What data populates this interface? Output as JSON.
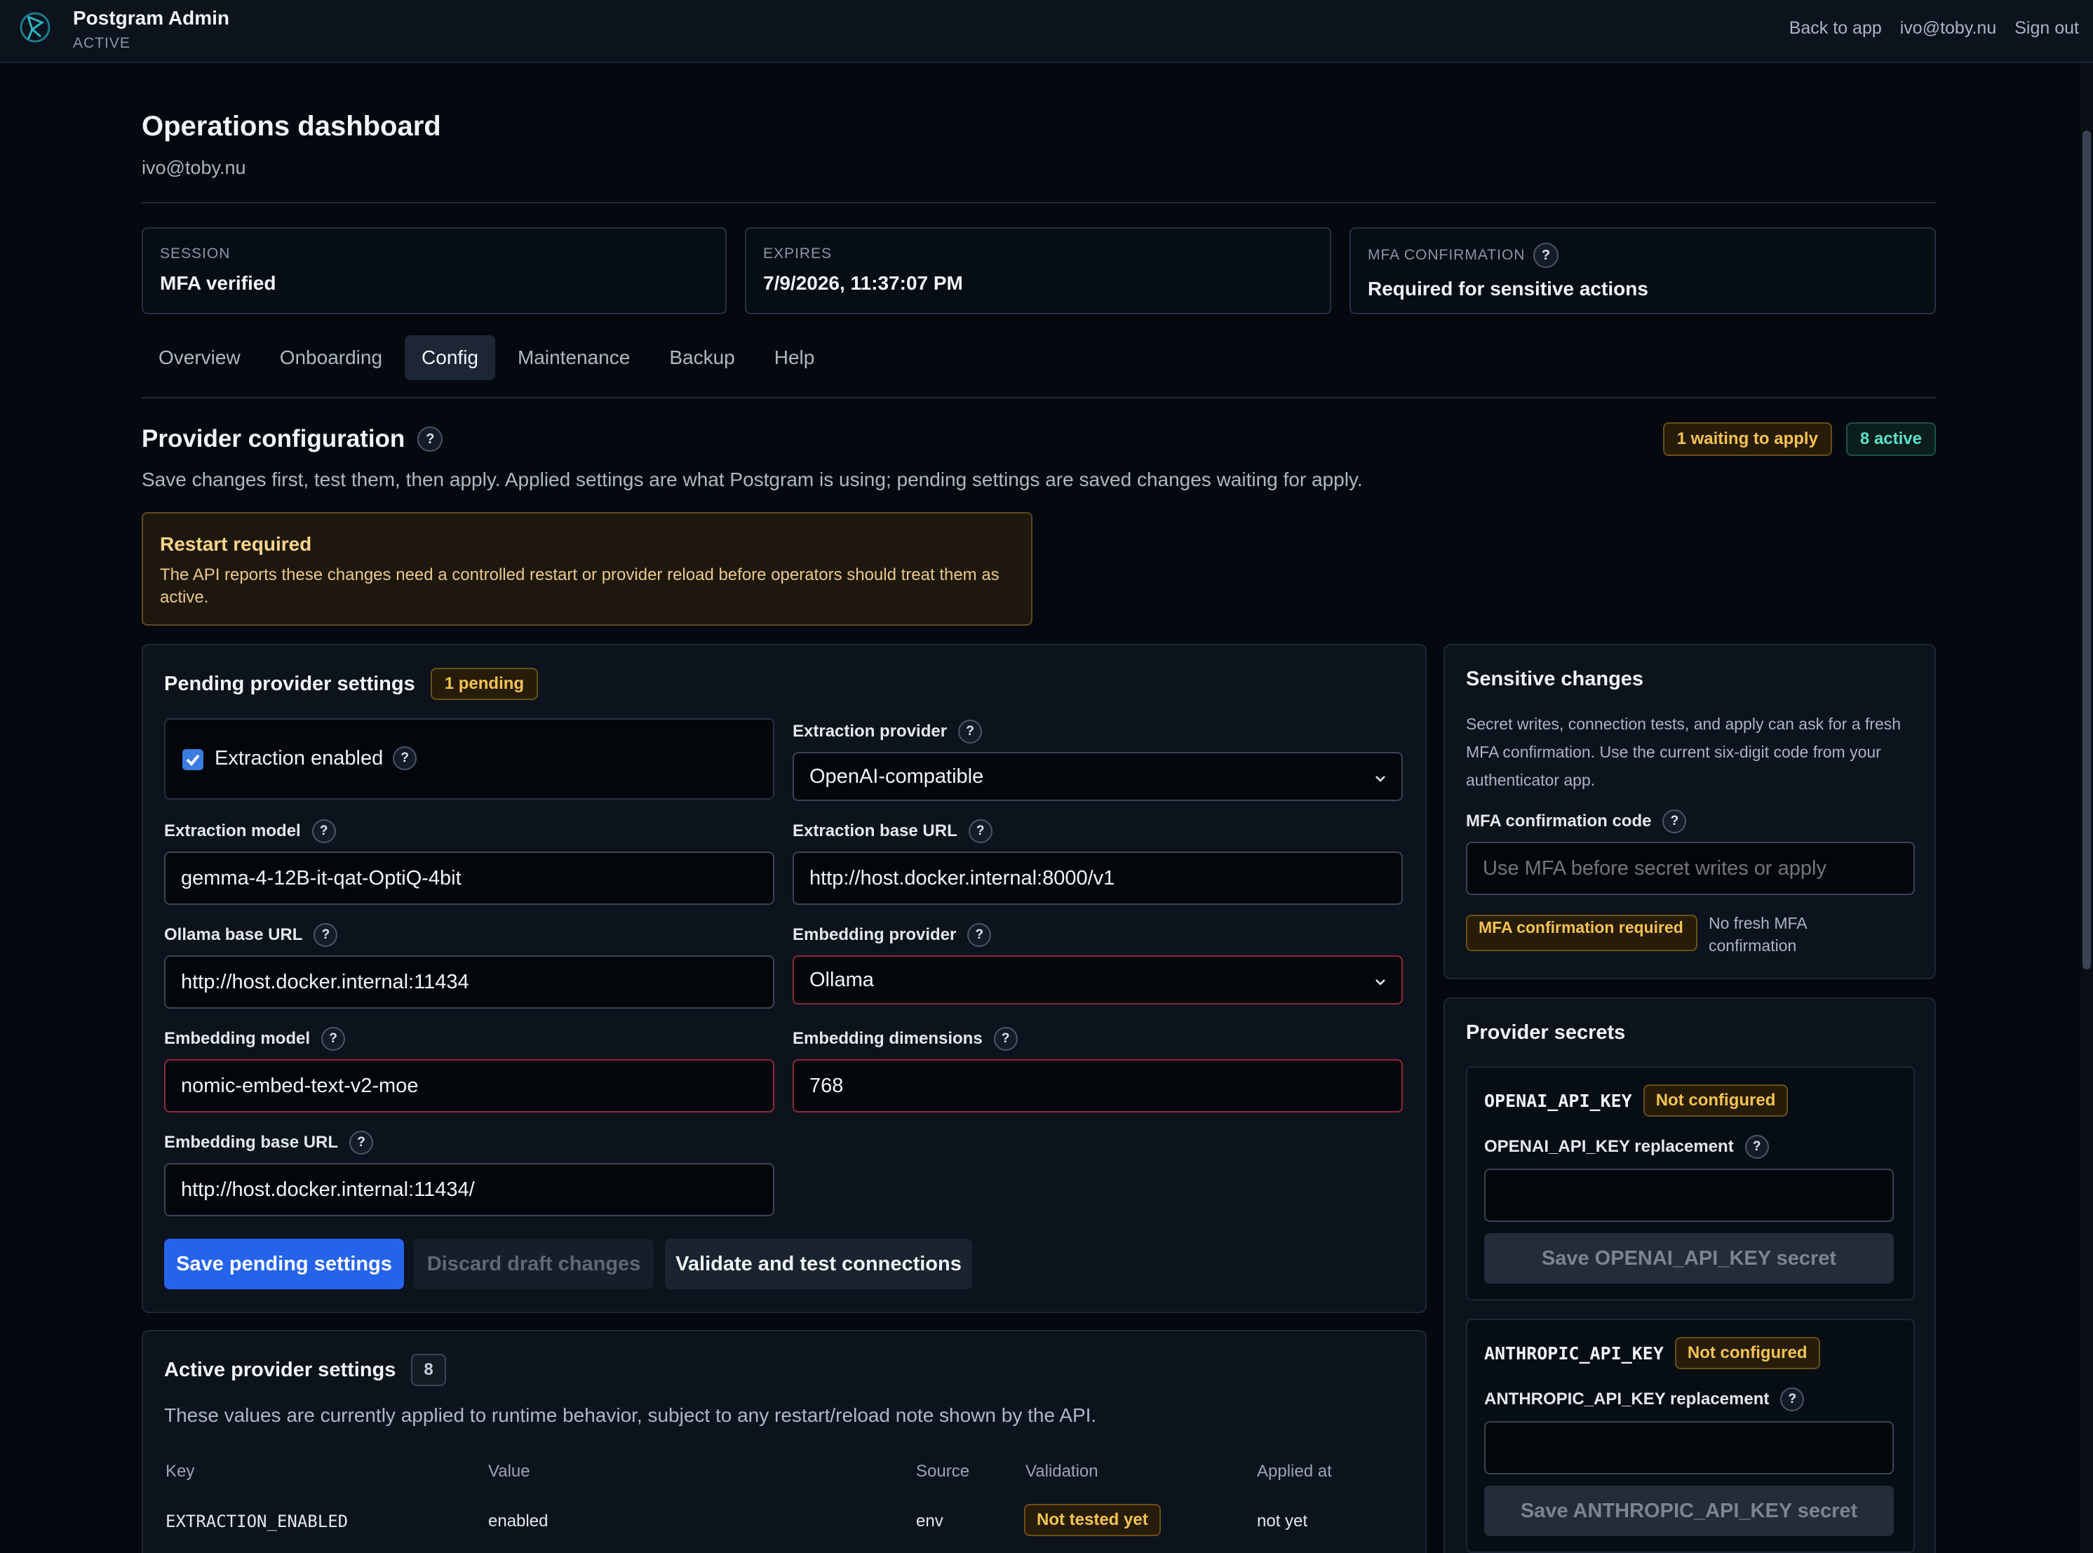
{
  "app": {
    "title": "Postgram Admin",
    "status": "ACTIVE"
  },
  "topnav": {
    "back": "Back to app",
    "user": "ivo@toby.nu",
    "signout": "Sign out"
  },
  "page": {
    "title": "Operations dashboard",
    "user": "ivo@toby.nu"
  },
  "cards": {
    "session": {
      "label": "SESSION",
      "value": "MFA verified"
    },
    "expires": {
      "label": "EXPIRES",
      "value": "7/9/2026, 11:37:07 PM"
    },
    "mfa": {
      "label": "MFA CONFIRMATION",
      "value": "Required for sensitive actions"
    }
  },
  "tabs": [
    "Overview",
    "Onboarding",
    "Config",
    "Maintenance",
    "Backup",
    "Help"
  ],
  "active_tab": "Config",
  "provider": {
    "title": "Provider configuration",
    "waiting_badge": "1 waiting to apply",
    "active_badge": "8 active",
    "description": "Save changes first, test them, then apply. Applied settings are what Postgram is using; pending settings are saved changes waiting for apply."
  },
  "alert": {
    "title": "Restart required",
    "text": "The API reports these changes need a controlled restart or provider reload before operators should treat them as active."
  },
  "pending": {
    "title": "Pending provider settings",
    "badge": "1 pending",
    "extraction_enabled_label": "Extraction enabled",
    "extraction_enabled": true,
    "fields": {
      "extraction_provider": {
        "label": "Extraction provider",
        "value": "OpenAI-compatible"
      },
      "extraction_model": {
        "label": "Extraction model",
        "value": "gemma-4-12B-it-qat-OptiQ-4bit"
      },
      "extraction_base_url": {
        "label": "Extraction base URL",
        "value": "http://host.docker.internal:8000/v1"
      },
      "ollama_base_url": {
        "label": "Ollama base URL",
        "value": "http://host.docker.internal:11434"
      },
      "embedding_provider": {
        "label": "Embedding provider",
        "value": "Ollama"
      },
      "embedding_model": {
        "label": "Embedding model",
        "value": "nomic-embed-text-v2-moe"
      },
      "embedding_dimensions": {
        "label": "Embedding dimensions",
        "value": "768"
      },
      "embedding_base_url": {
        "label": "Embedding base URL",
        "value": "http://host.docker.internal:11434/"
      }
    },
    "buttons": {
      "save": "Save pending settings",
      "discard": "Discard draft changes",
      "validate": "Validate and test connections"
    }
  },
  "active": {
    "title": "Active provider settings",
    "count": "8",
    "description": "These values are currently applied to runtime behavior, subject to any restart/reload note shown by the API.",
    "columns": [
      "Key",
      "Value",
      "Source",
      "Validation",
      "Applied at"
    ],
    "rows": [
      {
        "key": "EXTRACTION_ENABLED",
        "value": "enabled",
        "source": "env",
        "validation": "Not tested yet",
        "applied": "not yet"
      }
    ]
  },
  "sensitive": {
    "title": "Sensitive changes",
    "text": "Secret writes, connection tests, and apply can ask for a fresh MFA confirmation. Use the current six-digit code from your authenticator app.",
    "code_label": "MFA confirmation code",
    "code_placeholder": "Use MFA before secret writes or apply",
    "status_badge": "MFA confirmation required",
    "status_text": "No fresh MFA confirmation"
  },
  "secrets": {
    "title": "Provider secrets",
    "openai": {
      "name": "OPENAI_API_KEY",
      "status": "Not configured",
      "replacement_label": "OPENAI_API_KEY replacement",
      "button": "Save OPENAI_API_KEY secret"
    },
    "anthropic": {
      "name": "ANTHROPIC_API_KEY",
      "status": "Not configured",
      "replacement_label": "ANTHROPIC_API_KEY replacement",
      "button": "Save ANTHROPIC_API_KEY secret"
    }
  },
  "colors": {
    "background": "#04090f",
    "panel": "#0c131d",
    "accent": "#2563eb",
    "warning": "#f4c253",
    "success": "#5ce0c6",
    "error_border": "#8e2a37"
  }
}
